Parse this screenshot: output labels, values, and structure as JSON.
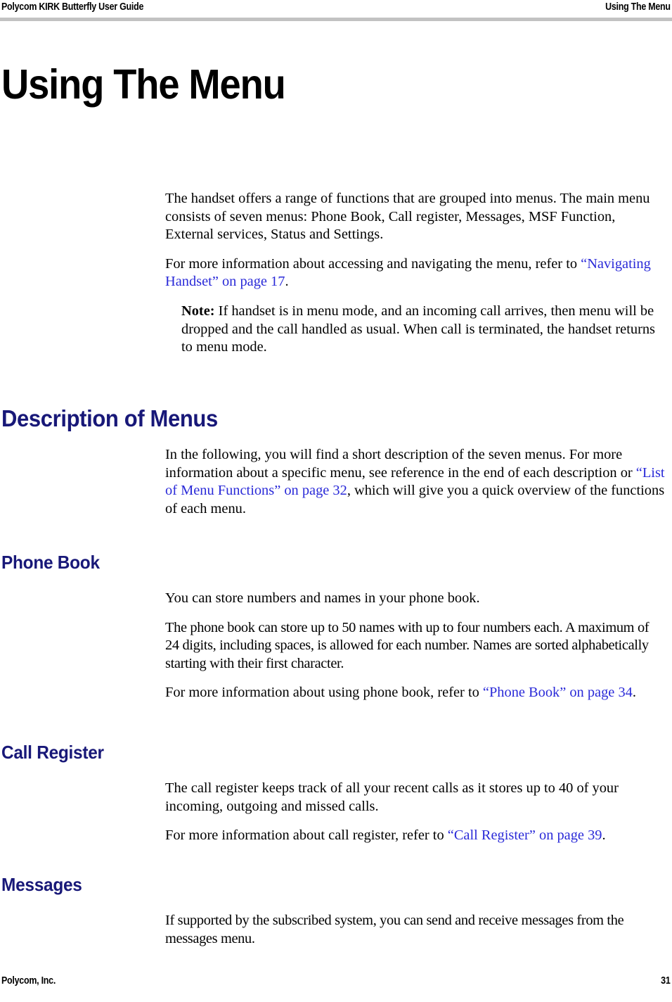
{
  "header": {
    "left": "Polycom KIRK Butterfly User Guide",
    "right": "Using The Menu",
    "rule_color": "#c2c2c2"
  },
  "footer": {
    "left": "Polycom, Inc.",
    "page_number": "31"
  },
  "colors": {
    "heading_blue": "#181878",
    "link_blue": "#2a2ad8",
    "text_black": "#000000"
  },
  "chapter": {
    "title": "Using The Menu"
  },
  "intro": {
    "paragraph_1": "The handset offers a range of functions that are grouped into menus. The main menu consists of seven menus: Phone Book, Call register, Messages, MSF Function, External services, Status and Settings.",
    "paragraph_2_prefix": "For more information about accessing and navigating the menu, refer to ",
    "paragraph_2_link": "“Navigating Handset” on page 17",
    "paragraph_2_suffix": ".",
    "note_label": "Note:",
    "note_text": " If handset is in menu mode, and an incoming call arrives, then menu will be dropped and the call handled as usual. When call is terminated, the handset returns to menu mode."
  },
  "sections": [
    {
      "heading": "Description of Menus",
      "level": "h1",
      "paragraph_prefix": "In the following, you will find a short description of the seven menus. For more information about a specific menu, see reference in the end of each description or ",
      "paragraph_link": "“List of Menu Functions” on page 32",
      "paragraph_suffix": ", which will give you a quick overview of the functions of each menu."
    },
    {
      "heading": "Phone Book",
      "level": "h2",
      "paragraph_1": "You can store numbers and names in your phone book.",
      "paragraph_2": "The phone book can store up to 50 names with up to four numbers each. A maximum of 24 digits, including spaces, is allowed for each number. Names are sorted alphabetically starting with their first character.",
      "paragraph_3_prefix": "For more information about using phone book, refer to ",
      "paragraph_3_link": "“Phone Book” on page 34",
      "paragraph_3_suffix": "."
    },
    {
      "heading": "Call Register",
      "level": "h2",
      "paragraph_1": "The call register keeps track of all your recent calls as it stores up to 40 of your incoming, outgoing and missed calls.",
      "paragraph_2_prefix": "For more information about call register, refer to ",
      "paragraph_2_link": "“Call Register” on page 39",
      "paragraph_2_suffix": "."
    },
    {
      "heading": "Messages",
      "level": "h2",
      "paragraph_1": "If supported by the subscribed system, you can send and receive messages from the messages menu."
    }
  ]
}
